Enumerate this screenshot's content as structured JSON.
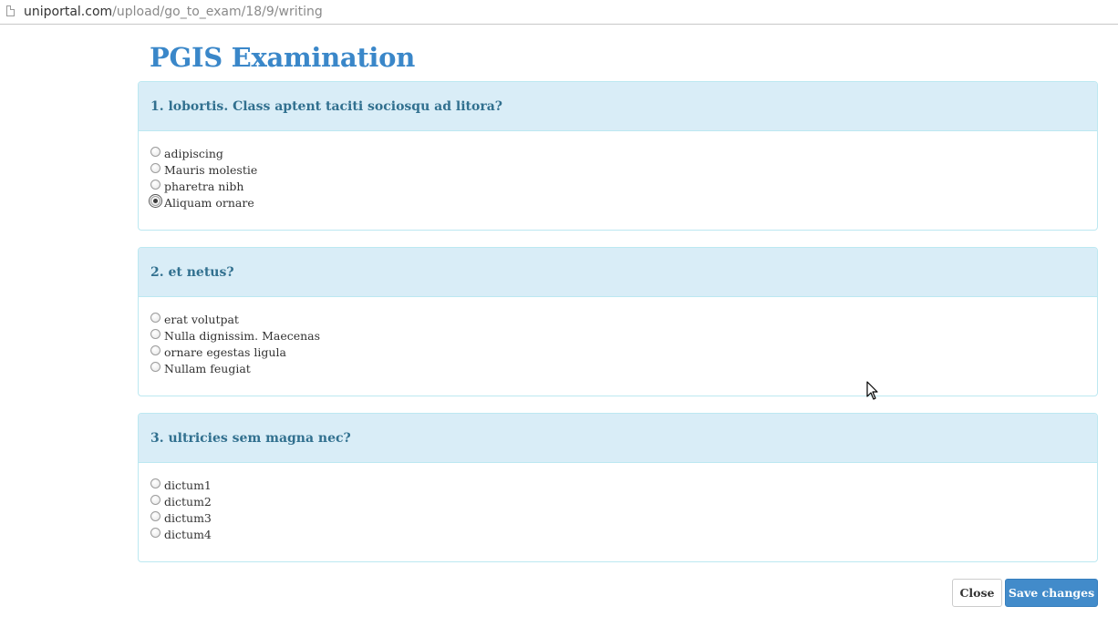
{
  "browser": {
    "url_host": "uniportal.com",
    "url_path": "/upload/go_to_exam/18/9/writing"
  },
  "page": {
    "title": "PGIS Examination"
  },
  "questions": [
    {
      "title": "1. lobortis. Class aptent taciti sociosqu ad litora?",
      "options": [
        "adipiscing",
        "Mauris molestie",
        "pharetra nibh",
        "Aliquam ornare"
      ],
      "selected_index": 3
    },
    {
      "title": "2. et netus?",
      "options": [
        "erat volutpat",
        "Nulla dignissim. Maecenas",
        "ornare egestas ligula",
        "Nullam feugiat"
      ],
      "selected_index": null
    },
    {
      "title": "3. ultricies sem magna nec?",
      "options": [
        "dictum1",
        "dictum2",
        "dictum3",
        "dictum4"
      ],
      "selected_index": null
    }
  ],
  "footer": {
    "close_label": "Close",
    "save_label": "Save changes"
  },
  "colors": {
    "title": "#3a87c9",
    "panel_heading_bg": "#d9edf7",
    "panel_heading_text": "#31708f",
    "panel_border": "#bce8f1",
    "primary_button": "#428bca"
  }
}
